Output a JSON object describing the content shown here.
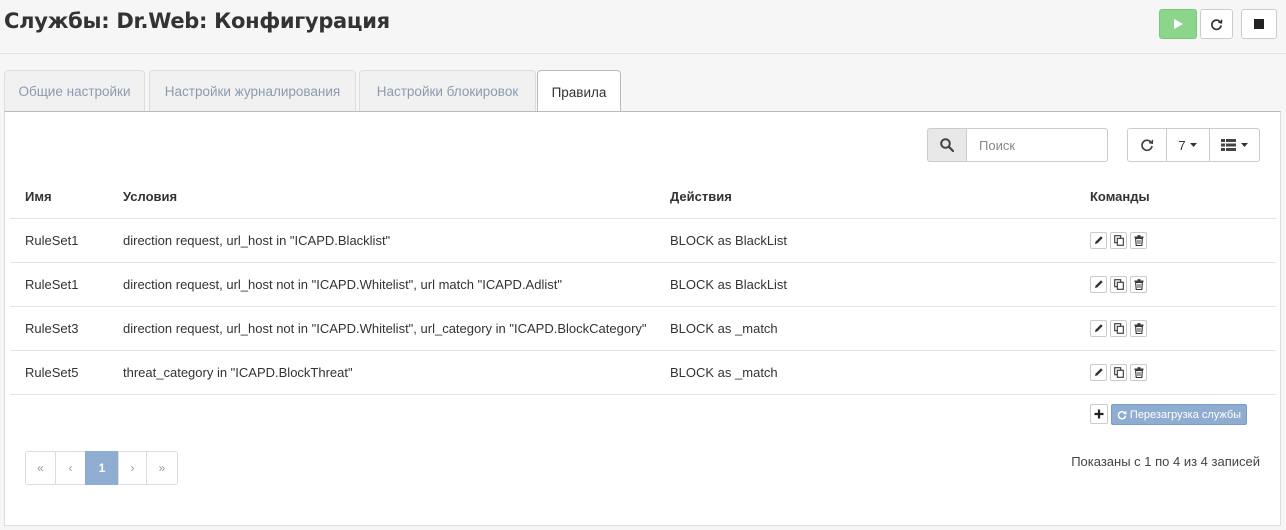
{
  "header": {
    "title": "Службы: Dr.Web: Конфигурация",
    "start_icon": "play-icon",
    "reload_icon": "refresh-icon",
    "stop_icon": "stop-icon",
    "start_color": "#8bd68b"
  },
  "tabs": [
    {
      "label": "Общие настройки"
    },
    {
      "label": "Настройки журналирования"
    },
    {
      "label": "Настройки блокировок"
    },
    {
      "label": "Правила",
      "active": true
    }
  ],
  "toolbar": {
    "search_placeholder": "Поиск",
    "page_size": "7",
    "refresh_icon": "refresh-icon",
    "columns_icon": "list-icon"
  },
  "table": {
    "columns": [
      "Имя",
      "Условия",
      "Действия",
      "Команды"
    ],
    "rows": [
      {
        "name": "RuleSet1",
        "conditions": "direction request, url_host in \"ICAPD.Blacklist\"",
        "actions": "BLOCK as BlackList"
      },
      {
        "name": "RuleSet1",
        "conditions": "direction request, url_host not in \"ICAPD.Whitelist\", url match \"ICAPD.Adlist\"",
        "actions": "BLOCK as BlackList"
      },
      {
        "name": "RuleSet3",
        "conditions": "direction request, url_host not in \"ICAPD.Whitelist\", url_category in \"ICAPD.BlockCategory\"",
        "actions": "BLOCK as _match"
      },
      {
        "name": "RuleSet5",
        "conditions": "threat_category in \"ICAPD.BlockThreat\"",
        "actions": "BLOCK as _match"
      }
    ]
  },
  "footer": {
    "restart_label": "Перезагрузка службы",
    "pagination": {
      "first": "«",
      "prev": "‹",
      "current": "1",
      "next": "›",
      "last": "»"
    },
    "info": "Показаны с 1 по 4 из 4 записей",
    "accent_color": "#8eadd1"
  }
}
